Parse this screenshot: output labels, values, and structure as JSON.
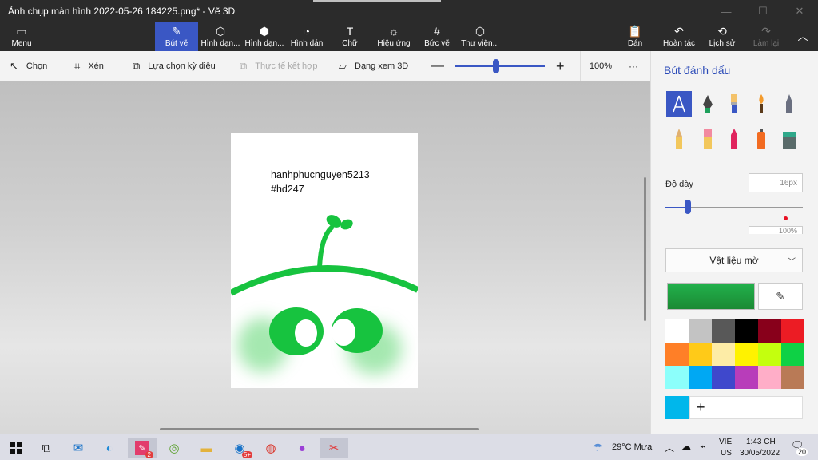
{
  "window": {
    "title": "Ảnh chụp màn hình 2022-05-26 184225.png* - Vẽ 3D",
    "controls": [
      "—",
      "☐",
      "✕"
    ]
  },
  "ribbon": {
    "menu": "Menu",
    "tools": [
      "Bút vẽ",
      "Hình dạn...",
      "Hình dạn...",
      "Hình dán",
      "Chữ",
      "Hiệu ứng",
      "Bức vẽ",
      "Thư viện..."
    ],
    "active_tool": "Bút vẽ",
    "right": [
      "Dán",
      "Hoàn tác",
      "Lịch sử",
      "Làm lại"
    ]
  },
  "toolbar": {
    "select": "Chọn",
    "crop": "Xén",
    "magic_select": "Lựa chọn kỳ diệu",
    "mixed_reality": "Thực tế kết hợp",
    "view_3d": "Dạng xem 3D",
    "zoom_percent": "100%",
    "more": "···",
    "zoom_level": 0.5
  },
  "canvas": {
    "line1": "hanhphucnguyen5213",
    "line2": "#hd247"
  },
  "panel": {
    "title": "Bút đánh dấu",
    "thickness_label": "Độ dày",
    "thickness_value": "16px",
    "opacity_value": "100%",
    "material": "Vật liệu mờ",
    "current_color": "#22b14c",
    "palette": [
      "#ffffff",
      "#c3c3c3",
      "#585858",
      "#000000",
      "#88001b",
      "#ec1c24",
      "#ff7f27",
      "#ffca18",
      "#fdeca6",
      "#fff200",
      "#c4ff0e",
      "#0ed145",
      "#8cfffb",
      "#00a8f3",
      "#3f48cc",
      "#b83dba",
      "#ffaec8",
      "#b97a56"
    ],
    "custom_color": "#00b7eb",
    "add": "+"
  },
  "taskbar": {
    "weather": "29°C  Mưa",
    "lang_1": "VIE",
    "lang_2": "US",
    "time": "1:43 CH",
    "date": "30/05/2022",
    "notif_count": "20",
    "badge_paint": "2",
    "badge_mail": "5+"
  }
}
